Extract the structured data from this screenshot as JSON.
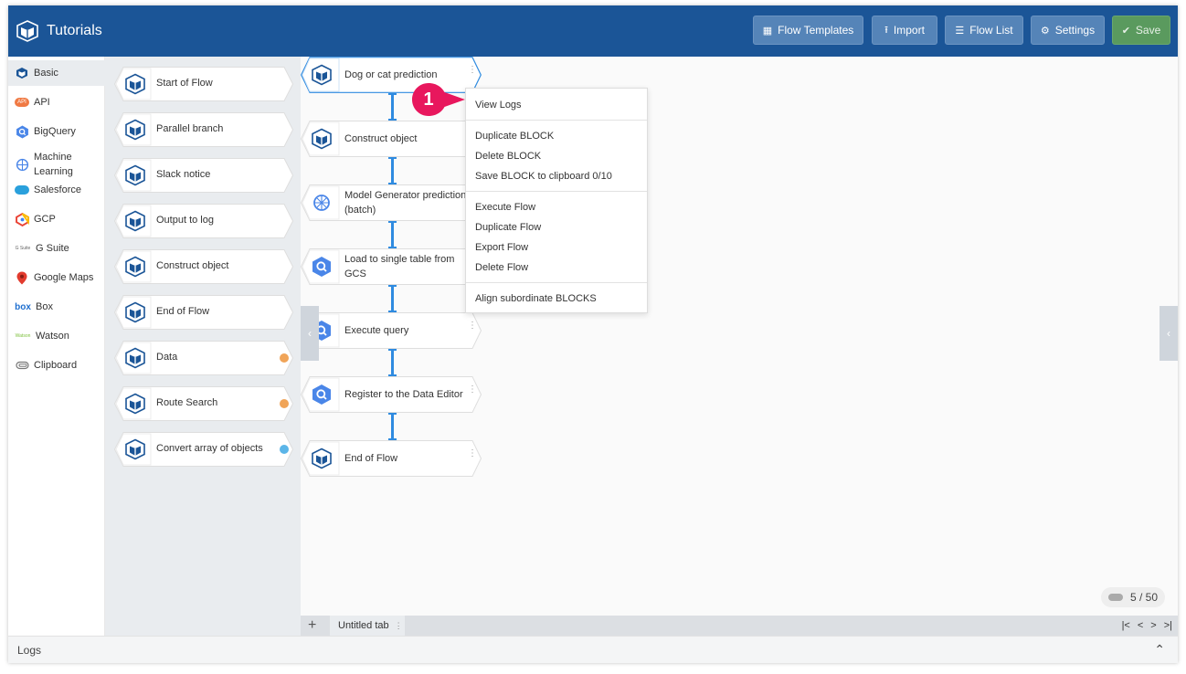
{
  "header": {
    "title": "Tutorials",
    "buttons": {
      "flow_templates": "Flow Templates",
      "import": "Import",
      "flow_list": "Flow List",
      "settings": "Settings",
      "save": "Save"
    }
  },
  "categories": [
    {
      "label": "Basic",
      "icon": "magellan-block-icon",
      "active": true
    },
    {
      "label": "API",
      "icon": "api-icon"
    },
    {
      "label": "BigQuery",
      "icon": "bigquery-icon"
    },
    {
      "label": "Machine Learning",
      "icon": "brain-icon"
    },
    {
      "label": "Salesforce",
      "icon": "salesforce-cloud-icon"
    },
    {
      "label": "GCP",
      "icon": "gcp-icon"
    },
    {
      "label": "G Suite",
      "icon": "gsuite-icon",
      "icon_text": "G Suite"
    },
    {
      "label": "Google Maps",
      "icon": "map-pin-icon"
    },
    {
      "label": "Box",
      "icon": "box-icon",
      "icon_text": "box"
    },
    {
      "label": "Watson",
      "icon": "watson-icon",
      "icon_text": "Watson"
    },
    {
      "label": "Clipboard",
      "icon": "paperclip-icon"
    }
  ],
  "palette": [
    {
      "label": "Start of Flow"
    },
    {
      "label": "Parallel branch"
    },
    {
      "label": "Slack notice"
    },
    {
      "label": "Output to log"
    },
    {
      "label": "Construct object"
    },
    {
      "label": "End of Flow"
    },
    {
      "label": "Data",
      "dot_color": "#f0a458"
    },
    {
      "label": "Route Search",
      "dot_color": "#f0a458"
    },
    {
      "label": "Convert array of objects",
      "dot_color": "#5bb5e8"
    }
  ],
  "flow": [
    {
      "label": "Dog or cat prediction",
      "icon": "magellan-block-icon",
      "selected": true
    },
    {
      "label": "Construct object",
      "icon": "magellan-block-icon"
    },
    {
      "label": "Model Generator prediction (batch)",
      "icon": "brain-icon"
    },
    {
      "label": "Load to single table from GCS",
      "icon": "bigquery-icon"
    },
    {
      "label": "Execute query",
      "icon": "bigquery-icon"
    },
    {
      "label": "Register to the Data Editor",
      "icon": "bigquery-icon"
    },
    {
      "label": "End of Flow",
      "icon": "magellan-block-icon"
    }
  ],
  "context_menu": {
    "groups": [
      [
        "View Logs"
      ],
      [
        "Duplicate BLOCK",
        "Delete BLOCK",
        "Save BLOCK to clipboard 0/10"
      ],
      [
        "Execute Flow",
        "Duplicate Flow",
        "Export Flow",
        "Delete Flow"
      ],
      [
        "Align subordinate BLOCKS"
      ]
    ]
  },
  "callout": {
    "number": "1",
    "color": "#e8175d"
  },
  "counter": {
    "text": "5 / 50"
  },
  "tabs": {
    "add": "+",
    "items": [
      {
        "label": "Untitled tab"
      }
    ]
  },
  "pager": {
    "first": "|<",
    "prev": "<",
    "next": ">",
    "last": ">|"
  },
  "logs": {
    "label": "Logs"
  },
  "colors": {
    "header": "#1b5597",
    "accent": "#2f8be0",
    "save": "#5a9a5e"
  }
}
